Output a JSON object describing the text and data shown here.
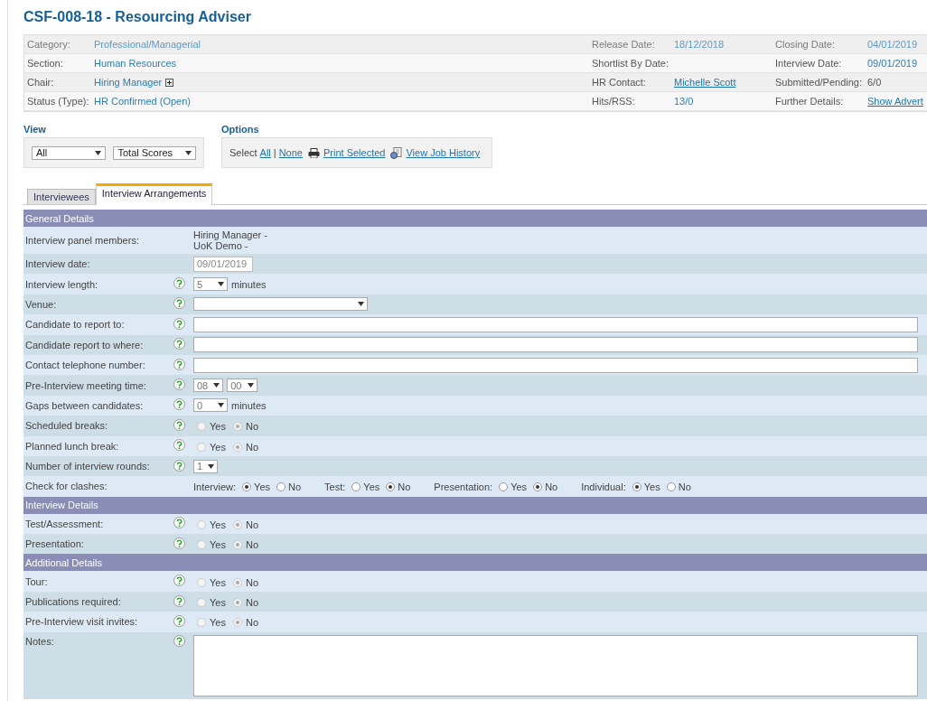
{
  "title": "CSF-008-18 - Resourcing Adviser",
  "header": {
    "rows": [
      {
        "fields": [
          {
            "label": "Category:",
            "value": "Professional/Managerial",
            "kind": "text"
          },
          {
            "label": "Release Date:",
            "value": "18/12/2018",
            "kind": "text"
          },
          {
            "label": "Closing Date:",
            "value": "04/01/2019",
            "kind": "text"
          }
        ]
      },
      {
        "fields": [
          {
            "label": "Section:",
            "value": "Human Resources",
            "kind": "text"
          },
          {
            "label": "Shortlist By Date:",
            "kind": "empty"
          },
          {
            "label": "Interview Date:",
            "value": "09/01/2019",
            "kind": "text"
          }
        ]
      },
      {
        "fields": [
          {
            "label": "Chair:",
            "value": "Hiring Manager",
            "kind": "expandable"
          },
          {
            "label": "HR Contact:",
            "value": "Michelle Scott",
            "kind": "link"
          },
          {
            "label": "Submitted/Pending:",
            "value": "6/0",
            "kind": "plain"
          }
        ]
      },
      {
        "fields": [
          {
            "label": "Status (Type):",
            "value": "HR Confirmed (Open)",
            "kind": "text"
          },
          {
            "label": "Hits/RSS:",
            "value": "13/0",
            "kind": "text"
          },
          {
            "label": "Further Details:",
            "value": "Show Advert",
            "kind": "link"
          }
        ]
      }
    ]
  },
  "view": {
    "label": "View",
    "selects": [
      "All",
      "Total Scores"
    ]
  },
  "options": {
    "label": "Options",
    "select_text": "Select",
    "links": [
      "All",
      "None"
    ],
    "separator": "|",
    "actions": [
      {
        "kind": "print",
        "label": "Print Selected"
      },
      {
        "kind": "history",
        "label": "View Job History"
      }
    ]
  },
  "tabs": [
    {
      "label": "Interviewees",
      "selected": false
    },
    {
      "label": "Interview Arrangements",
      "selected": true
    }
  ],
  "sections": [
    {
      "title": "General Details",
      "rows": [
        {
          "kind": "static",
          "label": "Interview panel members:",
          "help": false,
          "lines": [
            "Hiring Manager -",
            "UoK Demo -"
          ]
        },
        {
          "kind": "date",
          "label": "Interview date:",
          "help": false,
          "value": "09/01/2019",
          "disabled": true
        },
        {
          "kind": "select",
          "label": "Interview length:",
          "help": true,
          "values": [
            "5"
          ],
          "unit": "minutes"
        },
        {
          "kind": "wide-select",
          "label": "Venue:",
          "help": true
        },
        {
          "kind": "input",
          "label": "Candidate to report to:",
          "help": true
        },
        {
          "kind": "input",
          "label": "Candidate report to where:",
          "help": true
        },
        {
          "kind": "input",
          "label": "Contact telephone number:",
          "help": true
        },
        {
          "kind": "select",
          "label": "Pre-Interview meeting time:",
          "help": true,
          "values": [
            "08",
            "00"
          ]
        },
        {
          "kind": "select",
          "label": "Gaps between candidates:",
          "help": true,
          "values": [
            "0"
          ],
          "unit": "minutes"
        },
        {
          "kind": "radio",
          "label": "Scheduled breaks:",
          "help": true,
          "disabled": true,
          "options": [
            {
              "label": "Yes",
              "selected": false
            },
            {
              "label": "No",
              "selected": true
            }
          ]
        },
        {
          "kind": "radio",
          "label": "Planned lunch break:",
          "help": true,
          "disabled": true,
          "options": [
            {
              "label": "Yes",
              "selected": false
            },
            {
              "label": "No",
              "selected": true
            }
          ]
        },
        {
          "kind": "select",
          "label": "Number of interview rounds:",
          "help": true,
          "values": [
            "1"
          ]
        },
        {
          "kind": "clashes",
          "label": "Check for clashes:",
          "help": false,
          "groups": [
            {
              "label": "Interview:",
              "disabled": false,
              "options": [
                {
                  "label": "Yes",
                  "selected": true
                },
                {
                  "label": "No",
                  "selected": false
                }
              ]
            },
            {
              "label": "Test:",
              "disabled": false,
              "options": [
                {
                  "label": "Yes",
                  "selected": false
                },
                {
                  "label": "No",
                  "selected": true
                }
              ]
            },
            {
              "label": "Presentation:",
              "disabled": false,
              "options": [
                {
                  "label": "Yes",
                  "selected": false
                },
                {
                  "label": "No",
                  "selected": true
                }
              ]
            },
            {
              "label": "Individual:",
              "disabled": false,
              "options": [
                {
                  "label": "Yes",
                  "selected": true
                },
                {
                  "label": "No",
                  "selected": false
                }
              ]
            }
          ]
        }
      ]
    },
    {
      "title": "Interview Details",
      "rows": [
        {
          "kind": "radio",
          "label": "Test/Assessment:",
          "help": true,
          "disabled": true,
          "options": [
            {
              "label": "Yes",
              "selected": false
            },
            {
              "label": "No",
              "selected": true
            }
          ]
        },
        {
          "kind": "radio",
          "label": "Presentation:",
          "help": true,
          "disabled": true,
          "options": [
            {
              "label": "Yes",
              "selected": false
            },
            {
              "label": "No",
              "selected": true
            }
          ]
        }
      ]
    },
    {
      "title": "Additional Details",
      "rows": [
        {
          "kind": "radio",
          "label": "Tour:",
          "help": true,
          "disabled": true,
          "options": [
            {
              "label": "Yes",
              "selected": false
            },
            {
              "label": "No",
              "selected": true
            }
          ]
        },
        {
          "kind": "radio",
          "label": "Publications required:",
          "help": true,
          "disabled": true,
          "options": [
            {
              "label": "Yes",
              "selected": false
            },
            {
              "label": "No",
              "selected": true
            }
          ]
        },
        {
          "kind": "radio",
          "label": "Pre-Interview visit invites:",
          "help": true,
          "disabled": true,
          "options": [
            {
              "label": "Yes",
              "selected": false
            },
            {
              "label": "No",
              "selected": true
            }
          ]
        },
        {
          "kind": "textarea",
          "label": "Notes:",
          "help": true
        }
      ]
    }
  ]
}
